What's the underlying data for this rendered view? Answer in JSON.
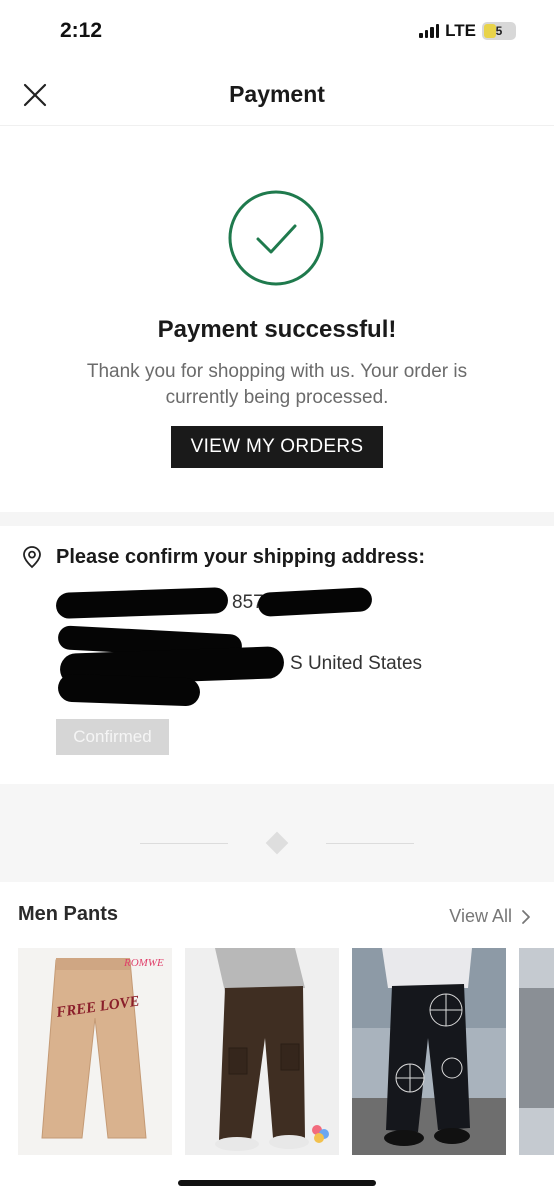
{
  "status_bar": {
    "time": "2:12",
    "network": "LTE",
    "battery": "5"
  },
  "nav": {
    "close_icon": "close-icon",
    "title": "Payment"
  },
  "success": {
    "icon": "check-circle-icon",
    "icon_color": "#1f7a4d",
    "title": "Payment successful!",
    "message": "Thank you for shopping with us. Your order is currently being processed.",
    "button_label": "VIEW MY ORDERS"
  },
  "shipping": {
    "icon": "location-pin-icon",
    "title": "Please confirm your shipping address:",
    "line1_visible": "857",
    "line2_visible": "S United States",
    "confirmed_label": "Confirmed"
  },
  "recommendations": {
    "title": "Men Pants",
    "view_all_label": "View All",
    "products": [
      {
        "name": "beige-sweatpants",
        "brand_label": "ROMWE",
        "print_text": "FREE LOVE",
        "color": "#d9b28e"
      },
      {
        "name": "brown-cargo-pants",
        "color": "#3f2e22"
      },
      {
        "name": "black-spiderweb-jeans",
        "color": "#15171c"
      },
      {
        "name": "partial-product",
        "color": "#8a8f95"
      }
    ]
  }
}
